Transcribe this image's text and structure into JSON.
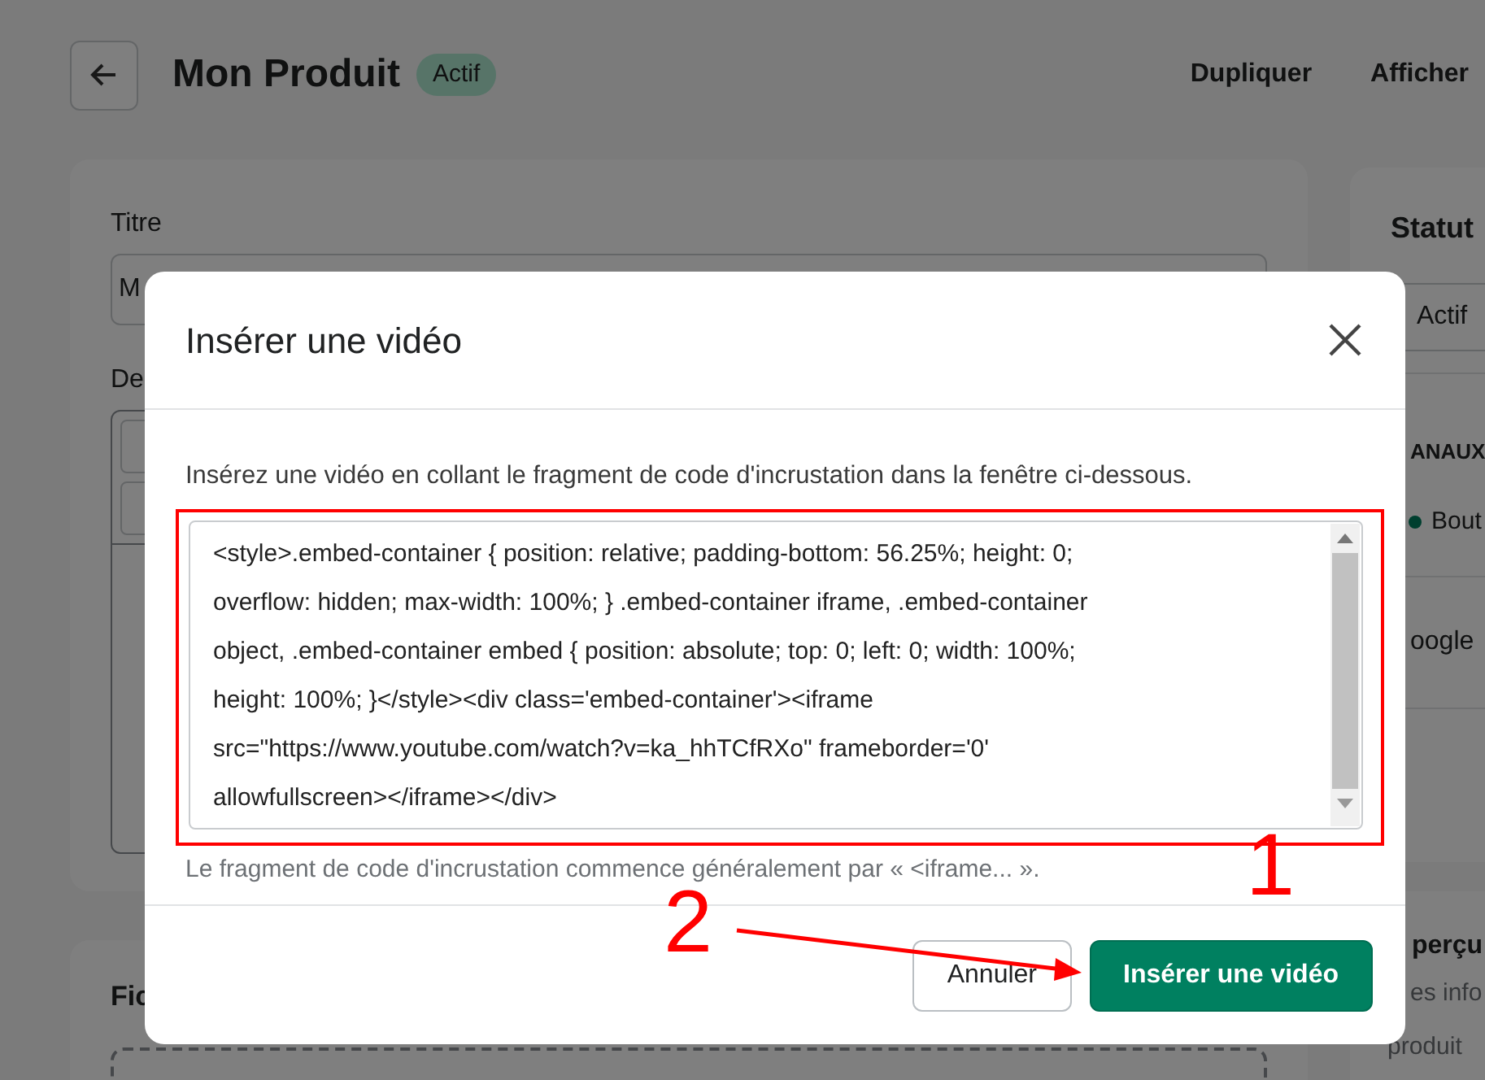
{
  "page": {
    "title": "Mon Produit",
    "status_badge": "Actif",
    "actions": [
      "Dupliquer",
      "Afficher"
    ],
    "main_card": {
      "title_label": "Titre",
      "title_value": "M",
      "description_label": "De"
    },
    "media_card": {
      "title": "Fic"
    },
    "status_card": {
      "title": "Statut",
      "select_value": "Actif",
      "channels_heading": "ANAUX",
      "channel": "Bout",
      "google_section": "oogle"
    },
    "preview_card": {
      "title": "perçu",
      "text_lines": [
        "es info",
        "produit"
      ]
    }
  },
  "modal": {
    "title": "Insérer une vidéo",
    "instruction": "Insérez une vidéo en collant le fragment de code d'incrustation dans la fenêtre ci-dessous.",
    "code_lines": [
      "<style>.embed-container { position: relative; padding-bottom: 56.25%; height: 0;",
      "overflow: hidden; max-width: 100%; } .embed-container iframe, .embed-container",
      "object, .embed-container embed { position: absolute; top: 0; left: 0; width: 100%;",
      "height: 100%; }</style><div class='embed-container'><iframe",
      "src=\"https://www.youtube.com/watch?v=ka_hhTCfRXo\" frameborder='0'",
      "allowfullscreen></iframe></div>"
    ],
    "hint": "Le fragment de code d'incrustation commence généralement par « <iframe... ».",
    "buttons": [
      {
        "label": "Annuler",
        "kind": "secondary"
      },
      {
        "label": "Insérer une vidéo",
        "kind": "primary"
      }
    ]
  },
  "annotations": {
    "labels": [
      "1",
      "2"
    ]
  }
}
